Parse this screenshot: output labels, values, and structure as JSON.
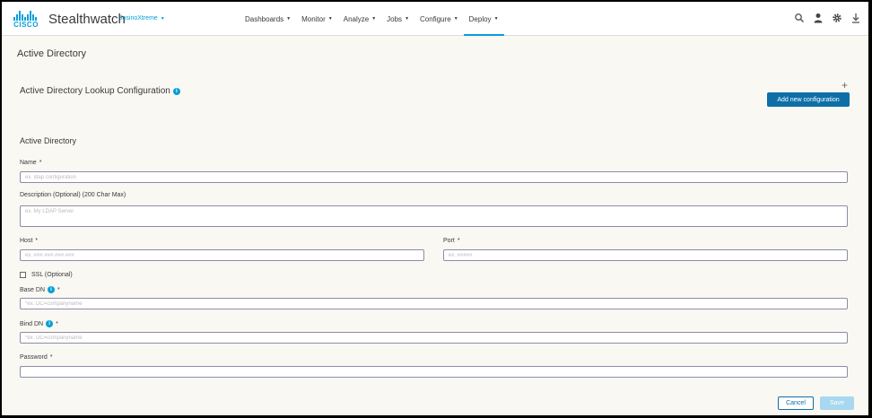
{
  "header": {
    "logo_text": "CISCO",
    "brand": "Stealthwatch",
    "tenant": "JosinoXtreme",
    "nav": [
      {
        "label": "Dashboards"
      },
      {
        "label": "Monitor"
      },
      {
        "label": "Analyze"
      },
      {
        "label": "Jobs"
      },
      {
        "label": "Configure"
      },
      {
        "label": "Deploy"
      }
    ],
    "active_nav": "Deploy",
    "icons": [
      "search-icon",
      "user-icon",
      "gear-icon",
      "download-icon"
    ]
  },
  "page": {
    "title": "Active Directory",
    "section_title": "Active Directory Lookup Configuration",
    "add_button": "Add new configuration",
    "plus": "+",
    "form_title": "Active Directory"
  },
  "form": {
    "required_mark": "*",
    "info_mark": "i",
    "name": {
      "label": "Name",
      "placeholder": "ex. ldap configuration",
      "value": ""
    },
    "description": {
      "label": "Description (Optional) (200 Char Max)",
      "placeholder": "ex. My LDAP Server",
      "value": ""
    },
    "host": {
      "label": "Host",
      "placeholder": "ex. ###.###.###.###",
      "value": ""
    },
    "port": {
      "label": "Port",
      "placeholder": "ex. #####",
      "value": ""
    },
    "ssl": {
      "label": "SSL (Optional)",
      "checked": false
    },
    "base_dn": {
      "label": "Base DN",
      "placeholder": "*ex. DC=companyname",
      "value": ""
    },
    "bind_dn": {
      "label": "Bind DN",
      "placeholder": "*ex. DC=companyname",
      "value": ""
    },
    "password": {
      "label": "Password",
      "placeholder": "",
      "value": ""
    }
  },
  "actions": {
    "cancel": "Cancel",
    "save": "Save"
  },
  "colors": {
    "accent": "#049fd9",
    "primary_button": "#0d6fa8",
    "disabled_button": "#a8d8ef",
    "background": "#faf8f2"
  }
}
